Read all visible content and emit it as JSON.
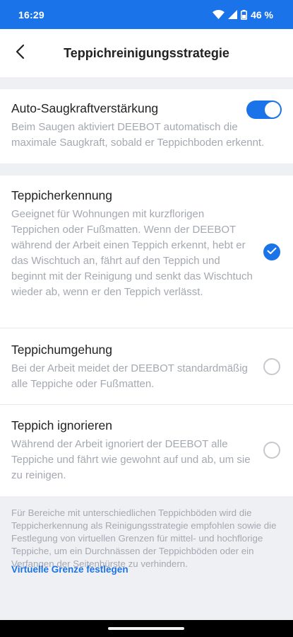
{
  "status_bar": {
    "time": "16:29",
    "battery": "46 %",
    "icons": [
      "wifi-icon",
      "signal-icon",
      "battery-icon"
    ]
  },
  "header": {
    "title": "Teppichreinigungsstrategie",
    "back_icon": "chevron-left-icon"
  },
  "auto_suction": {
    "title": "Auto-Saugkraftverstärkung",
    "description": "Beim Saugen aktiviert DEEBOT automatisch die maximale Saugkraft, sobald er Teppichboden erkennt.",
    "enabled": true
  },
  "strategies": [
    {
      "title": "Teppicherkennung",
      "description": "Geeignet für Wohnungen mit kurzflorigen Teppichen oder Fußmatten. Wenn der DEEBOT während der Arbeit einen Teppich erkennt, hebt er das Wischtuch an, fährt auf den Teppich und beginnt mit der Reinigung und senkt das Wischtuch wieder ab, wenn er den Teppich verlässt.",
      "selected": true
    },
    {
      "title": "Teppichumgehung",
      "description": "Bei der Arbeit meidet der DEEBOT standardmäßig alle Teppiche oder Fußmatten.",
      "selected": false
    },
    {
      "title": "Teppich ignorieren",
      "description": "Während der Arbeit ignoriert der DEEBOT alle Teppiche und fährt wie gewohnt auf und ab, um sie zu reinigen.",
      "selected": false
    }
  ],
  "footer": {
    "note": "Für Bereiche mit unterschiedlichen Teppichböden wird die Teppicherkennung als Reinigungsstrategie empfohlen sowie die Festlegung von virtuellen Grenzen für mittel- und hochflorige Teppiche, um ein Durchnässen der Teppichböden oder ein Verfangen der Seitenbürste zu verhindern.",
    "link": "Virtuelle Grenze festlegen"
  },
  "colors": {
    "accent": "#1a73e8",
    "background": "#eef0f4",
    "text": "#222222",
    "muted_text": "#a4a8b0"
  }
}
